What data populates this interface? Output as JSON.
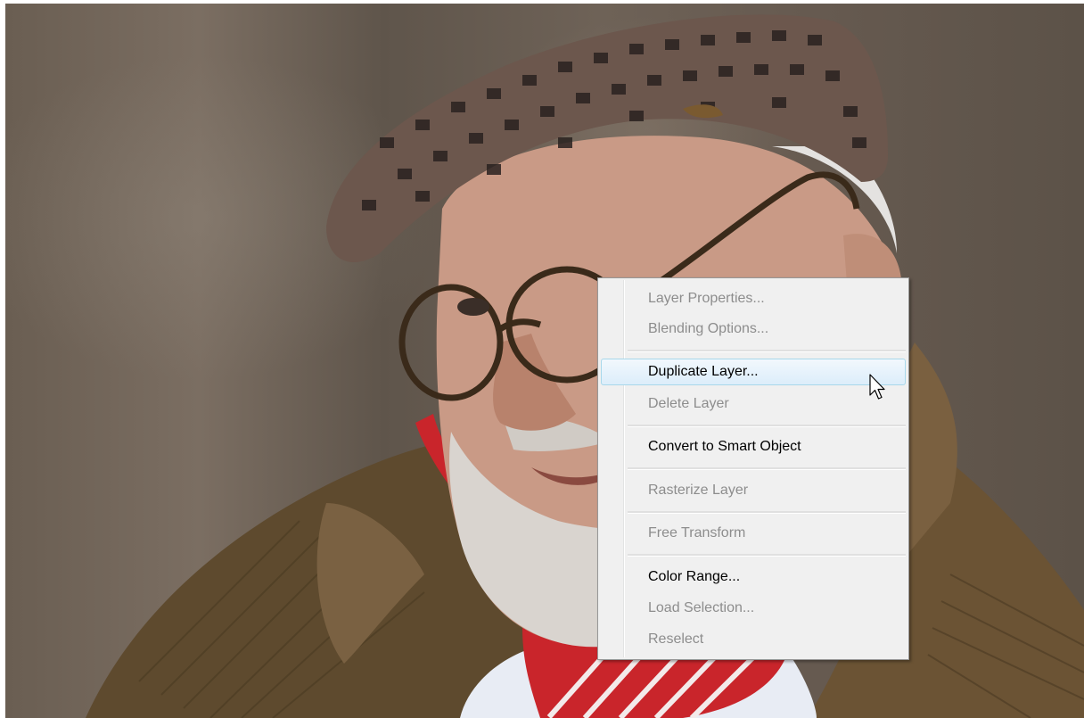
{
  "context_menu": {
    "items": [
      {
        "label": "Layer Properties...",
        "enabled": false
      },
      {
        "label": "Blending Options...",
        "enabled": false
      },
      {
        "label": "Duplicate Layer...",
        "enabled": true,
        "highlighted": true
      },
      {
        "label": "Delete Layer",
        "enabled": false
      },
      {
        "label": "Convert to Smart Object",
        "enabled": true
      },
      {
        "label": "Rasterize Layer",
        "enabled": false
      },
      {
        "label": "Free Transform",
        "enabled": false
      },
      {
        "label": "Color Range...",
        "enabled": true
      },
      {
        "label": "Load Selection...",
        "enabled": false
      },
      {
        "label": "Reselect",
        "enabled": false
      }
    ]
  },
  "cursor": {
    "icon": "arrow-pointer-icon"
  },
  "colors": {
    "menu_background": "#f0f0f0",
    "menu_border": "#979797",
    "highlight_border": "#a8d8eb",
    "disabled_text": "#8d8d8d"
  }
}
